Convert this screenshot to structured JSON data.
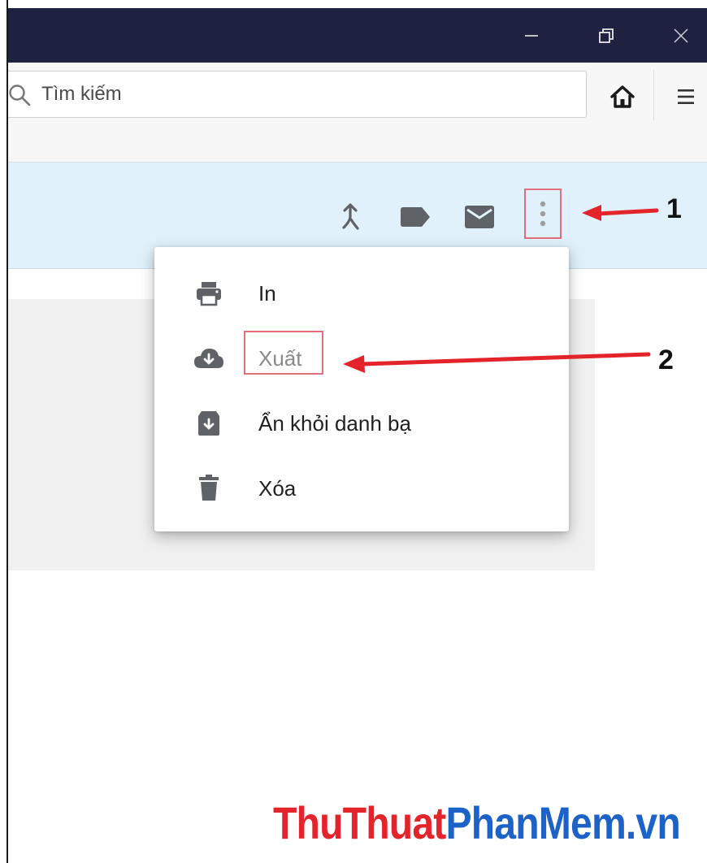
{
  "window": {
    "controls": {
      "minimize_icon": "minimize-icon",
      "restore_icon": "restore-icon",
      "close_icon": "close-icon"
    }
  },
  "toolbar": {
    "search": {
      "placeholder": "Tìm kiếm",
      "value": ""
    },
    "home_icon": "home-icon",
    "menu_icon": "hamburger-menu-icon"
  },
  "app_header": {
    "icons": [
      "merge-icon",
      "label-icon",
      "mail-icon",
      "more-vertical-icon"
    ]
  },
  "dropdown_menu": {
    "items": [
      {
        "label": "In",
        "icon": "print-icon"
      },
      {
        "label": "Xuất",
        "icon": "cloud-download-icon",
        "state": "disabled"
      },
      {
        "label": "Ẩn khỏi danh bạ",
        "icon": "archive-icon"
      },
      {
        "label": "Xóa",
        "icon": "trash-icon"
      }
    ]
  },
  "annotations": {
    "step1": "1",
    "step2": "2",
    "color": "#e3242b"
  },
  "watermark": {
    "part1": "ThuThuat",
    "part2": "PhanMem.vn",
    "color1": "#e3242b",
    "color2": "#1d63c7"
  },
  "colors": {
    "titlebar": "#1e2140",
    "header_bg": "#e0f1fb",
    "icon_grey": "#616161",
    "highlight": "#e36f7a"
  }
}
